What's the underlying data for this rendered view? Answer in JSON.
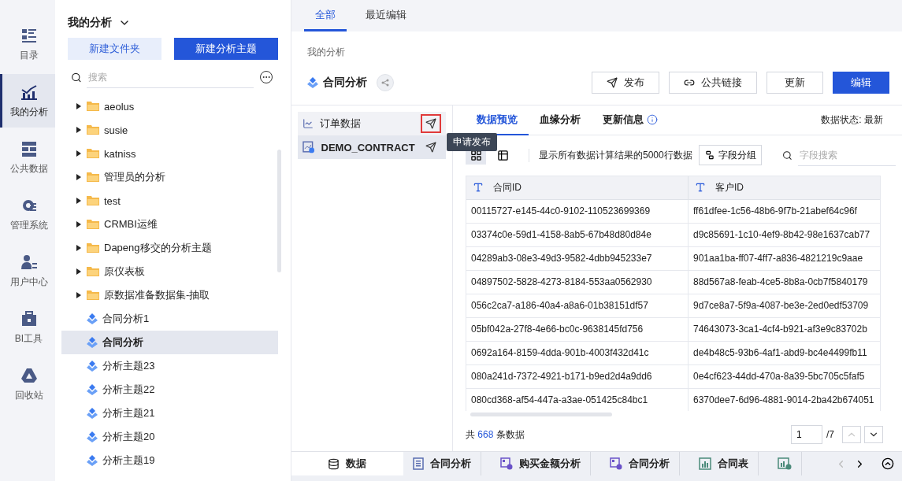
{
  "nav": [
    {
      "label": "目录",
      "selected": false
    },
    {
      "label": "我的分析",
      "selected": true
    },
    {
      "label": "公共数据",
      "selected": false
    },
    {
      "label": "管理系统",
      "selected": false
    },
    {
      "label": "用户中心",
      "selected": false
    },
    {
      "label": "BI工具",
      "selected": false
    },
    {
      "label": "回收站",
      "selected": false
    }
  ],
  "tree": {
    "title": "我的分析",
    "new_folder": "新建文件夹",
    "new_topic": "新建分析主题",
    "search": {
      "placeholder": "搜索"
    },
    "items": [
      {
        "kind": "folder",
        "label": "aeolus",
        "selected": false
      },
      {
        "kind": "folder",
        "label": "susie",
        "selected": false
      },
      {
        "kind": "folder",
        "label": "katniss",
        "selected": false
      },
      {
        "kind": "folder",
        "label": "管理员的分析",
        "selected": false
      },
      {
        "kind": "folder",
        "label": "test",
        "selected": false
      },
      {
        "kind": "folder",
        "label": "CRMBI运维",
        "selected": false
      },
      {
        "kind": "folder",
        "label": "Dapeng移交的分析主题",
        "selected": false
      },
      {
        "kind": "folder",
        "label": "原仪表板",
        "selected": false
      },
      {
        "kind": "folder",
        "label": "原数据准备数据集-抽取",
        "selected": false
      },
      {
        "kind": "topic",
        "label": "合同分析1",
        "selected": false
      },
      {
        "kind": "topic",
        "label": "合同分析",
        "selected": true
      },
      {
        "kind": "topic",
        "label": "分析主题23",
        "selected": false
      },
      {
        "kind": "topic",
        "label": "分析主题22",
        "selected": false
      },
      {
        "kind": "topic",
        "label": "分析主题21",
        "selected": false
      },
      {
        "kind": "topic",
        "label": "分析主题20",
        "selected": false
      },
      {
        "kind": "topic",
        "label": "分析主题19",
        "selected": false
      }
    ]
  },
  "top_tabs": [
    {
      "label": "全部",
      "selected": true
    },
    {
      "label": "最近编辑",
      "selected": false
    }
  ],
  "breadcrumb": "我的分析",
  "title": "合同分析",
  "actions": [
    {
      "kind": "publish",
      "label": "发布"
    },
    {
      "kind": "link",
      "label": "公共链接"
    },
    {
      "kind": "plain",
      "label": "更新"
    },
    {
      "kind": "primary",
      "label": "编辑"
    }
  ],
  "datasets": [
    {
      "kind": "chart",
      "label": "订单数据",
      "selected": false,
      "highlighted": true
    },
    {
      "kind": "contract",
      "label": "DEMO_CONTRACT",
      "selected": true,
      "highlighted": false
    }
  ],
  "tooltip": "申请发布",
  "detail_tabs": [
    {
      "label": "数据预览",
      "selected": true,
      "info": false
    },
    {
      "label": "血缘分析",
      "selected": false,
      "info": false
    },
    {
      "label": "更新信息",
      "selected": false,
      "info": true
    }
  ],
  "data_status": "数据状态: 最新",
  "views": [
    {
      "kind": "grid",
      "selected": true
    },
    {
      "kind": "table",
      "selected": false
    }
  ],
  "notice": "显示所有数据计算结果的5000行数据",
  "group_button": "字段分组",
  "field_search": {
    "placeholder": "字段搜索"
  },
  "table": {
    "columns": [
      "合同ID",
      "客户ID"
    ],
    "rows": [
      [
        "00115727-e145-44c0-9102-110523699369",
        "ff61dfee-1c56-48b6-9f7b-21abef64c96f"
      ],
      [
        "03374c0e-59d1-4158-8ab5-67b48d80d84e",
        "d9c85691-1c10-4ef9-8b42-98e1637cab77"
      ],
      [
        "04289ab3-08e3-49d3-9582-4dbb945233e7",
        "901aa1ba-ff07-4ff7-a836-4821219c9aae"
      ],
      [
        "04897502-5828-4273-8184-553aa0562930",
        "88d567a8-feab-4ce5-8b8a-0cb7f5840179"
      ],
      [
        "056c2ca7-a186-40a4-a8a6-01b38151df57",
        "9d7ce8a7-5f9a-4087-be3e-2ed0edf53709"
      ],
      [
        "05bf042a-27f8-4e66-bc0c-9638145fd756",
        "74643073-3ca1-4cf4-b921-af3e9c83702b"
      ],
      [
        "0692a164-8159-4dda-901b-4003f432d41c",
        "de4b48c5-93b6-4af1-abd9-bc4e4499fb11"
      ],
      [
        "080a241d-7372-4921-b171-b9ed2d4a9dd6",
        "0e4cf623-44dd-470a-8a39-5bc705c5faf5"
      ],
      [
        "080cd368-af54-447a-a3ae-051425c84bc1",
        "6370dee7-6d96-4881-9014-2ba42b674051"
      ]
    ]
  },
  "total": {
    "prefix": "共",
    "count": "668",
    "suffix": "条数据"
  },
  "pager": {
    "page": "1",
    "pages": "/7"
  },
  "bottom_tabs": [
    {
      "kind": "data",
      "label": "数据",
      "selected": true
    },
    {
      "kind": "report",
      "label": "合同分析",
      "selected": false
    },
    {
      "kind": "component",
      "label": "购买金额分析",
      "selected": false
    },
    {
      "kind": "component",
      "label": "合同分析",
      "selected": false
    },
    {
      "kind": "table",
      "label": "合同表",
      "selected": false
    },
    {
      "kind": "table-cut",
      "selected": false
    }
  ]
}
